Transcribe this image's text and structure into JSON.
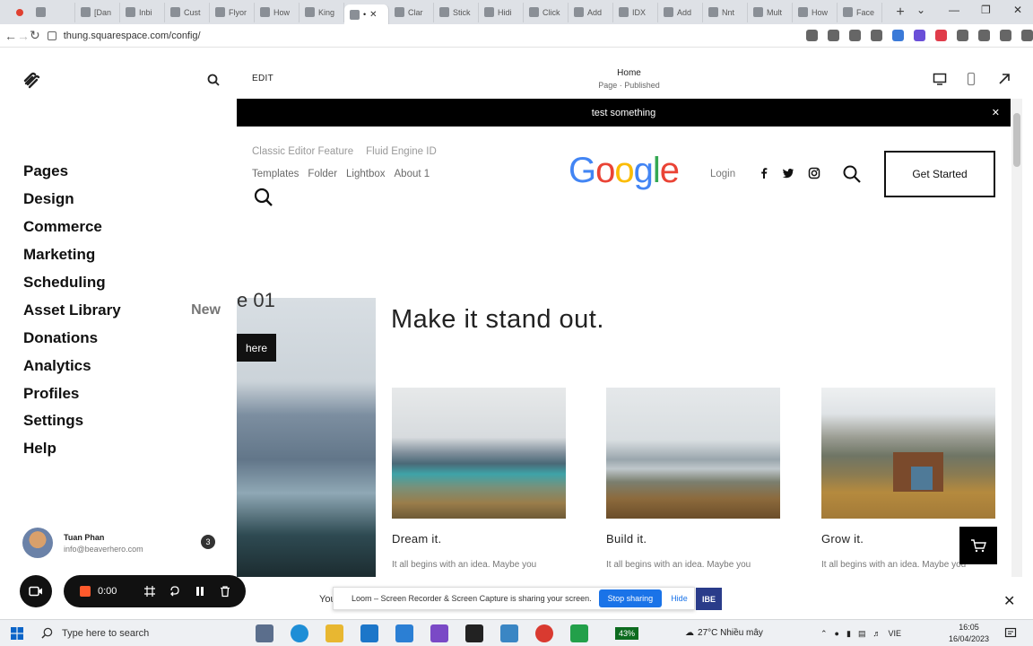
{
  "browser": {
    "tabs": [
      {
        "label": "",
        "active": false
      },
      {
        "label": "[Dan",
        "active": false
      },
      {
        "label": "Inbi",
        "active": false
      },
      {
        "label": "Cust",
        "active": false
      },
      {
        "label": "Flyor",
        "active": false
      },
      {
        "label": "How",
        "active": false
      },
      {
        "label": "King",
        "active": false
      },
      {
        "label": "•",
        "active": true
      },
      {
        "label": "Clar",
        "active": false
      },
      {
        "label": "Stick",
        "active": false
      },
      {
        "label": "Hidi",
        "active": false
      },
      {
        "label": "Click",
        "active": false
      },
      {
        "label": "Add",
        "active": false
      },
      {
        "label": "IDX",
        "active": false
      },
      {
        "label": "Add",
        "active": false
      },
      {
        "label": "Nnt",
        "active": false
      },
      {
        "label": "Mult",
        "active": false
      },
      {
        "label": "How",
        "active": false
      },
      {
        "label": "Face",
        "active": false
      }
    ],
    "url": "thung.squarespace.com/config/"
  },
  "sidebar": {
    "menu": [
      {
        "label": "Pages",
        "tag": ""
      },
      {
        "label": "Design",
        "tag": ""
      },
      {
        "label": "Commerce",
        "tag": ""
      },
      {
        "label": "Marketing",
        "tag": ""
      },
      {
        "label": "Scheduling",
        "tag": ""
      },
      {
        "label": "Asset Library",
        "tag": "New"
      },
      {
        "label": "Donations",
        "tag": ""
      },
      {
        "label": "Analytics",
        "tag": ""
      },
      {
        "label": "Profiles",
        "tag": ""
      },
      {
        "label": "Settings",
        "tag": ""
      },
      {
        "label": "Help",
        "tag": ""
      }
    ],
    "user": {
      "name": "Tuan Phan",
      "email": "info@beaverhero.com",
      "badge": "3"
    }
  },
  "editor": {
    "edit_label": "EDIT",
    "page_title": "Home",
    "page_status": "Page · Published"
  },
  "site": {
    "announcement": "test something",
    "nav_top": [
      "Classic Editor Feature",
      "Fluid Engine ID"
    ],
    "nav_main": [
      "Templates",
      "Folder",
      "Lightbox",
      "About 1"
    ],
    "logo": "Google",
    "login": "Login",
    "cta": "Get Started",
    "slide_label": "e 01",
    "slide_button": "here",
    "hero_title": "Make it stand out.",
    "cards": [
      {
        "title": "Dream it.",
        "text": "It all begins with an idea. Maybe you"
      },
      {
        "title": "Build it.",
        "text": "It all begins with an idea. Maybe you"
      },
      {
        "title": "Grow it.",
        "text": "It all begins with an idea. Maybe you"
      }
    ]
  },
  "recorder": {
    "timer": "0:00",
    "share_message": "Loom – Screen Recorder & Screen Capture is sharing your screen.",
    "stop_label": "Stop sharing",
    "hide_label": "Hide",
    "behind_text": "You",
    "behind_button": "IBE"
  },
  "taskbar": {
    "search_placeholder": "Type here to search",
    "battery": "43%",
    "weather": "27°C  Nhiều mây",
    "language": "VIE",
    "time": "16:05",
    "date": "16/04/2023"
  }
}
